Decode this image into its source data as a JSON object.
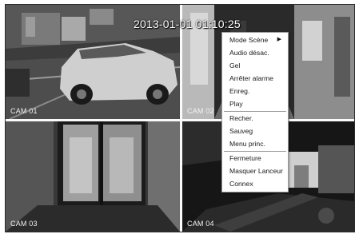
{
  "timestamp": "2013-01-01 01:10:25",
  "cameras": [
    {
      "label": "CAM 01"
    },
    {
      "label": "CAM 02"
    },
    {
      "label": "CAM 03"
    },
    {
      "label": "CAM 04"
    }
  ],
  "context_menu": {
    "items": [
      {
        "label": "Mode Scène",
        "has_submenu": true,
        "submenu_icon": "triangle-right-icon"
      },
      {
        "label": "Audio désac."
      },
      {
        "label": "Gel"
      },
      {
        "label": "Arrêter alarme"
      },
      {
        "label": "Enreg."
      },
      {
        "label": "Play"
      },
      {
        "label": "Recher."
      },
      {
        "label": "Sauveg"
      },
      {
        "label": "Menu princ."
      },
      {
        "label": "Fermeture"
      },
      {
        "label": "Masquer Lanceur"
      },
      {
        "label": "Connex"
      }
    ],
    "colors": {
      "background": "#ffffff",
      "text": "#1a1a1a",
      "separator": "#9b9b9b"
    }
  }
}
